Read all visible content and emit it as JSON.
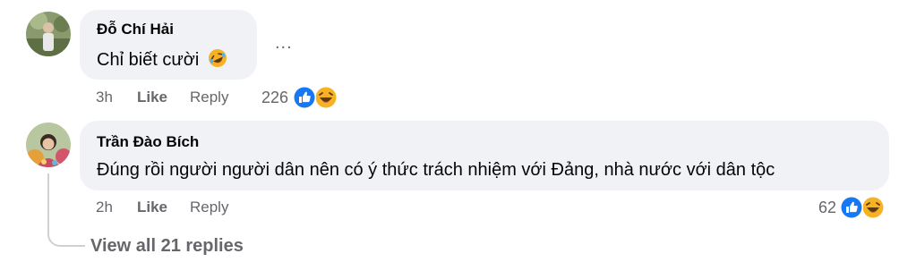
{
  "comments": [
    {
      "author": "Đỗ Chí Hải",
      "text": "Chỉ biết cười",
      "text_emoji": "rolling-on-floor-laughing-emoji",
      "time": "3h",
      "like_label": "Like",
      "reply_label": "Reply",
      "reaction_count": "226",
      "reactions": [
        "like-reaction-icon",
        "haha-reaction-icon"
      ],
      "more_label": "..."
    },
    {
      "author": "Trần Đào Bích",
      "text": "Đúng rồi người người dân nên có ý thức trách nhiệm với Đảng, nhà nước với dân tộc",
      "time": "2h",
      "like_label": "Like",
      "reply_label": "Reply",
      "reaction_count": "62",
      "reactions": [
        "like-reaction-icon",
        "haha-reaction-icon"
      ]
    }
  ],
  "thread": {
    "view_replies_label": "View all 21 replies"
  },
  "colors": {
    "bubble_bg": "#f0f2f5",
    "secondary_text": "#65676b",
    "like_blue": "#1877f2",
    "haha_yellow": "#f7b125",
    "thread_line": "#ced0d4"
  }
}
